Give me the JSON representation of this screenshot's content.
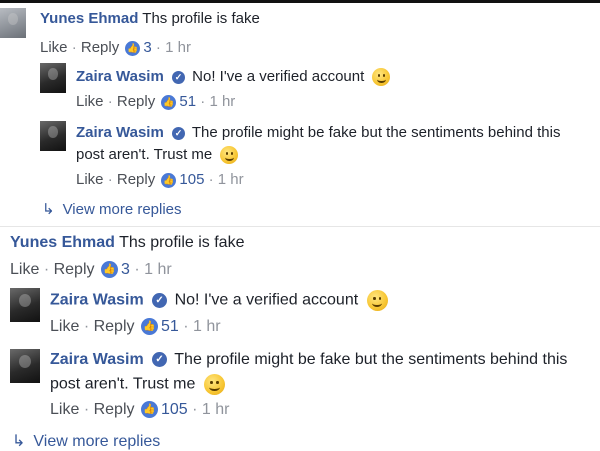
{
  "ui": {
    "like": "Like",
    "reply": "Reply",
    "sep": "·",
    "view_more": "View more replies",
    "verified_check": "✓",
    "thumb": "👍",
    "reply_arrow": "↳"
  },
  "threads": [
    {
      "top": {
        "author": "Yunes Ehmad",
        "text": "Ths profile is fake",
        "likes": "3",
        "time": "1 hr"
      },
      "replies": [
        {
          "author": "Zaira Wasim",
          "text": "No! I've a verified account",
          "likes": "51",
          "time": "1 hr"
        },
        {
          "author": "Zaira Wasim",
          "text_line1": "The profile might be fake but the sentiments behind this",
          "text_line2": "post aren't. Trust me",
          "likes": "105",
          "time": "1 hr"
        }
      ]
    },
    {
      "top": {
        "author": "Yunes Ehmad",
        "text": "Ths profile is fake",
        "likes": "3",
        "time": "1 hr"
      },
      "replies": [
        {
          "author": "Zaira Wasim",
          "text": "No! I've a verified account",
          "likes": "51",
          "time": "1 hr"
        },
        {
          "author": "Zaira Wasim",
          "text_line1": "The profile might be fake but the sentiments behind this",
          "text_line2": "post aren't. Trust me",
          "likes": "105",
          "time": "1 hr"
        }
      ]
    }
  ],
  "colors": {
    "link": "#365899",
    "meta": "#90949c",
    "like_badge": "#4a79d6",
    "verified": "#4267b2"
  }
}
